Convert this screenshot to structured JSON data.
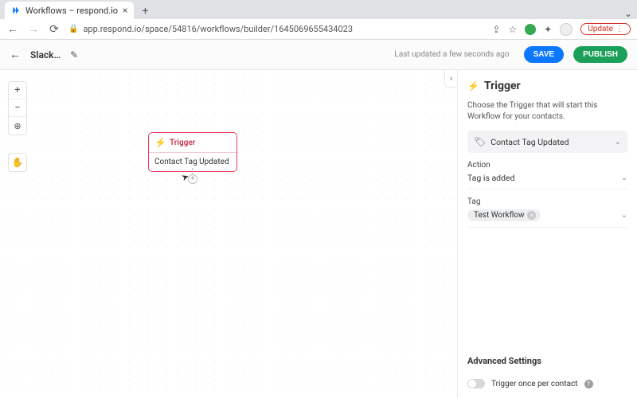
{
  "browser": {
    "tab_title": "Workflows – respond.io",
    "url": "app.respond.io/space/54816/workflows/builder/1645069655434023",
    "update_label": "Update"
  },
  "header": {
    "title": "Slack…",
    "last_updated": "Last updated a few seconds ago",
    "save_label": "SAVE",
    "publish_label": "PUBLISH"
  },
  "canvas": {
    "node": {
      "title": "Trigger",
      "subtitle": "Contact Tag Updated"
    }
  },
  "sidebar": {
    "title": "Trigger",
    "description": "Choose the Trigger that will start this Workflow for your contacts.",
    "trigger_type": "Contact Tag Updated",
    "action_label": "Action",
    "action_value": "Tag is added",
    "tag_label": "Tag",
    "tag_chip": "Test Workflow",
    "advanced_title": "Advanced Settings",
    "toggle_label": "Trigger once per contact"
  }
}
